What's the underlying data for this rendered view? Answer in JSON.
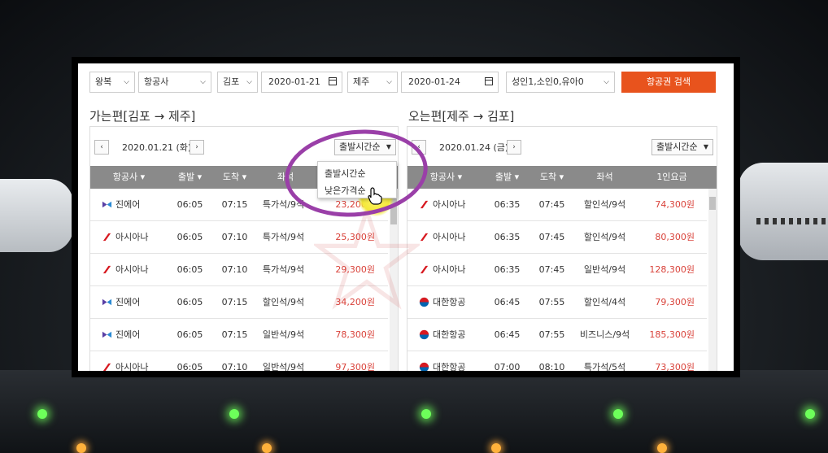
{
  "search": {
    "trip_type": "왕복",
    "airline": "항공사",
    "from": "김포",
    "depart_date": "2020-01-21",
    "to": "제주",
    "return_date": "2020-01-24",
    "passengers": "성인1,소인0,유아0",
    "search_button": "항공권 검색"
  },
  "outbound": {
    "title": "가는편[김포 → 제주]",
    "date": "2020.01.21 (화)",
    "sort": "출발시간순",
    "sort_options": [
      "출발시간순",
      "낮은가격순"
    ],
    "columns": [
      "항공사 ▾",
      "출발 ▾",
      "도착 ▾",
      "좌석"
    ],
    "rows": [
      {
        "airline": "진에어",
        "logo": "jinair-icon",
        "dep": "06:05",
        "arr": "07:15",
        "seat": "특가석/9석",
        "price": "23,200원"
      },
      {
        "airline": "아시아나",
        "logo": "asiana-icon",
        "dep": "06:05",
        "arr": "07:10",
        "seat": "특가석/9석",
        "price": "25,300원"
      },
      {
        "airline": "아시아나",
        "logo": "asiana-icon",
        "dep": "06:05",
        "arr": "07:10",
        "seat": "특가석/9석",
        "price": "29,300원"
      },
      {
        "airline": "진에어",
        "logo": "jinair-icon",
        "dep": "06:05",
        "arr": "07:15",
        "seat": "할인석/9석",
        "price": "34,200원"
      },
      {
        "airline": "진에어",
        "logo": "jinair-icon",
        "dep": "06:05",
        "arr": "07:15",
        "seat": "일반석/9석",
        "price": "78,300원"
      },
      {
        "airline": "아시아나",
        "logo": "asiana-icon",
        "dep": "06:05",
        "arr": "07:10",
        "seat": "일반석/9석",
        "price": "97,300원"
      }
    ]
  },
  "inbound": {
    "title": "오는편[제주 → 김포]",
    "date": "2020.01.24 (금)",
    "sort": "출발시간순",
    "columns": [
      "항공사 ▾",
      "출발 ▾",
      "도착 ▾",
      "좌석",
      "1인요금"
    ],
    "rows": [
      {
        "airline": "아시아나",
        "logo": "asiana-icon",
        "dep": "06:35",
        "arr": "07:45",
        "seat": "할인석/9석",
        "price": "74,300원"
      },
      {
        "airline": "아시아나",
        "logo": "asiana-icon",
        "dep": "06:35",
        "arr": "07:45",
        "seat": "할인석/9석",
        "price": "80,300원"
      },
      {
        "airline": "아시아나",
        "logo": "asiana-icon",
        "dep": "06:35",
        "arr": "07:45",
        "seat": "일반석/9석",
        "price": "128,300원"
      },
      {
        "airline": "대한항공",
        "logo": "koreanair-icon",
        "dep": "06:45",
        "arr": "07:55",
        "seat": "할인석/4석",
        "price": "79,300원"
      },
      {
        "airline": "대한항공",
        "logo": "koreanair-icon",
        "dep": "06:45",
        "arr": "07:55",
        "seat": "비즈니스/9석",
        "price": "185,300원"
      },
      {
        "airline": "대한항공",
        "logo": "koreanair-icon",
        "dep": "07:00",
        "arr": "08:10",
        "seat": "특가석/5석",
        "price": "73,300원"
      }
    ]
  },
  "pager": {
    "prev": "‹",
    "next": "›"
  },
  "colors": {
    "accent": "#e8531d",
    "price": "#d9423a",
    "highlight": "#9a3fa8",
    "header": "#8a8a8a"
  }
}
